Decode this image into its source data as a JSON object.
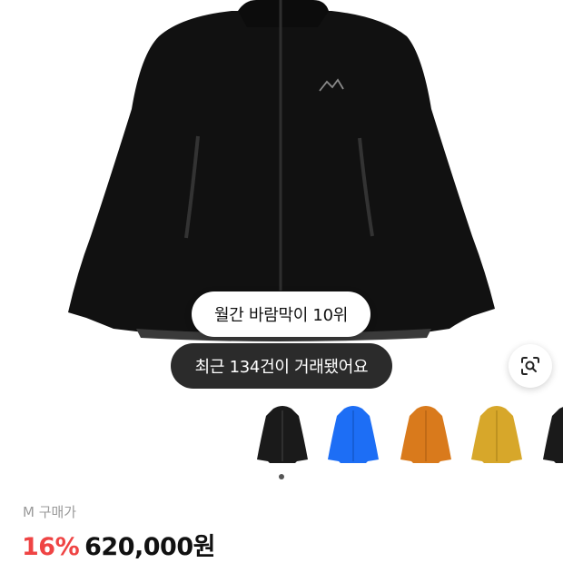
{
  "product_image": {
    "subject": "black-shell-jacket"
  },
  "badges": {
    "rank": "월간 바람막이 10위",
    "trades": "최근 134건이 거래됐어요"
  },
  "lens_button": {
    "icon": "lens-search-icon"
  },
  "thumbnails": [
    {
      "color": "#1a1a1a",
      "selected": true
    },
    {
      "color": "#1d6ef5",
      "selected": false
    },
    {
      "color": "#d97a1c",
      "selected": false
    },
    {
      "color": "#d7a72a",
      "selected": false
    },
    {
      "color": "#1a1a1a",
      "selected": false
    }
  ],
  "purchase": {
    "size_label": "M 구매가",
    "discount": "16%",
    "price": "620,000원"
  },
  "colors": {
    "discount": "#ef4444",
    "dark_pill": "#2b2b2b"
  }
}
